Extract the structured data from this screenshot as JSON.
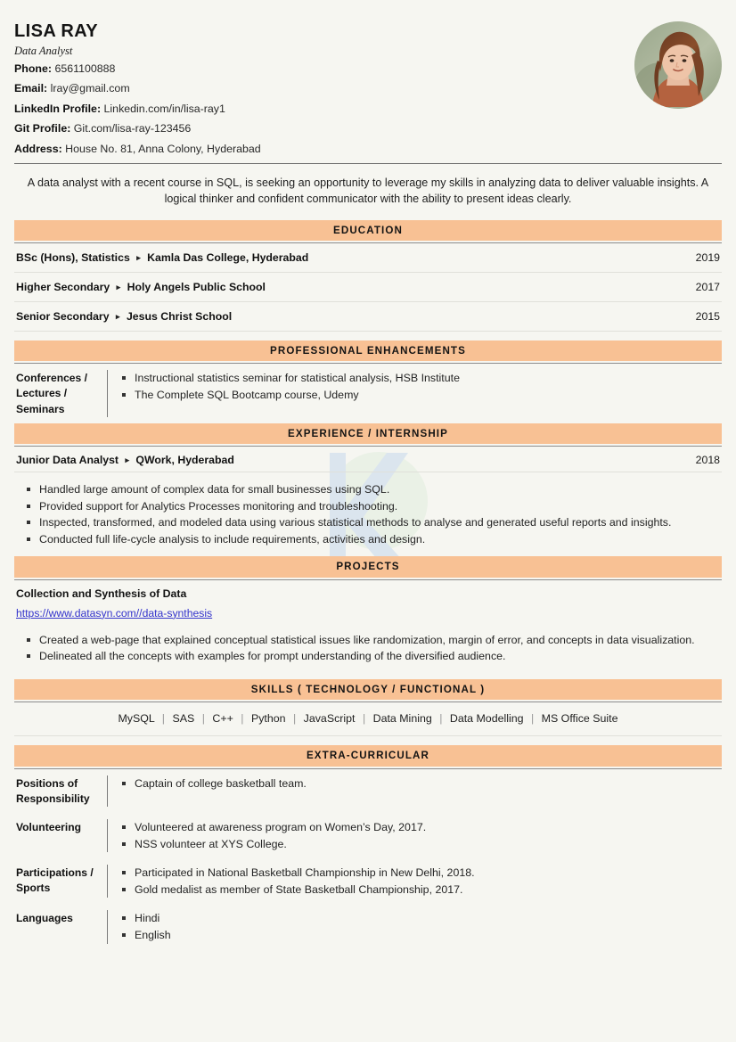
{
  "profile": {
    "name": "LISA RAY",
    "role": "Data Analyst",
    "contacts": [
      {
        "label": "Phone:",
        "value": "6561100888"
      },
      {
        "label": "Email:",
        "value": "lray@gmail.com"
      },
      {
        "label": "LinkedIn Profile:",
        "value": "Linkedin.com/in/lisa-ray1"
      },
      {
        "label": "Git Profile:",
        "value": "Git.com/lisa-ray-123456"
      },
      {
        "label": "Address:",
        "value": "House No. 81, Anna Colony, Hyderabad"
      }
    ],
    "photo_alt": "profile-photo"
  },
  "summary": "A data analyst with a recent course in SQL, is seeking an opportunity to leverage my skills in analyzing data to deliver valuable insights. A logical thinker and confident communicator with the ability to present ideas clearly.",
  "sections": {
    "education": {
      "title": "EDUCATION",
      "entries": [
        {
          "degree": "BSc (Hons), Statistics",
          "institute": "Kamla Das College, Hyderabad",
          "year": "2019"
        },
        {
          "degree": "Higher Secondary",
          "institute": "Holy Angels Public School",
          "year": "2017"
        },
        {
          "degree": "Senior Secondary",
          "institute": "Jesus Christ School",
          "year": "2015"
        }
      ]
    },
    "professional_enhancements": {
      "title": "PROFESSIONAL ENHANCEMENTS",
      "rows": [
        {
          "key": "Conferences / Lectures / Seminars",
          "items": [
            "Instructional statistics seminar for statistical analysis, HSB Institute",
            "The Complete SQL Bootcamp course, Udemy"
          ]
        }
      ]
    },
    "experience": {
      "title": "EXPERIENCE / INTERNSHIP",
      "entries": [
        {
          "role": "Junior Data Analyst",
          "company": "QWork, Hyderabad",
          "year": "2018",
          "bullets": [
            "Handled large amount of complex data for small businesses using SQL.",
            "Provided support for Analytics Processes monitoring and troubleshooting.",
            "Inspected, transformed, and modeled data using various statistical methods to analyse and generated useful reports and insights.",
            "Conducted full life-cycle analysis to include requirements, activities and design."
          ]
        }
      ]
    },
    "projects": {
      "title": "PROJECTS",
      "entries": [
        {
          "name": "Collection and Synthesis of Data",
          "link": "https://www.datasyn.com//data-synthesis",
          "bullets": [
            "Created a web-page that explained conceptual statistical issues like randomization, margin of error, and concepts in data visualization.",
            "Delineated all the concepts with examples for prompt understanding of the diversified audience."
          ]
        }
      ]
    },
    "skills": {
      "title": "SKILLS ( TECHNOLOGY / FUNCTIONAL )",
      "items": [
        "MySQL",
        "SAS",
        "C++",
        "Python",
        "JavaScript",
        "Data Mining",
        "Data Modelling",
        "MS Office Suite"
      ],
      "separator": "|"
    },
    "extra_curricular": {
      "title": "EXTRA-CURRICULAR",
      "rows": [
        {
          "key": "Positions of Responsibility",
          "items": [
            "Captain of college basketball team."
          ]
        },
        {
          "key": "Volunteering",
          "items": [
            "Volunteered at awareness program on Women’s Day, 2017.",
            "NSS volunteer at XYS College."
          ]
        },
        {
          "key": "Participations / Sports",
          "items": [
            "Participated in National Basketball Championship in New Delhi, 2018.",
            "Gold medalist as member of State Basketball Championship, 2017."
          ]
        },
        {
          "key": "Languages",
          "items": [
            "Hindi",
            "English"
          ]
        }
      ]
    }
  },
  "colors": {
    "section_bar": "#f8c194",
    "page_background": "#f6f6f1",
    "link": "#3333cc",
    "text": "#1c1c1c"
  },
  "icons": {
    "separator_triangle": "▸"
  }
}
